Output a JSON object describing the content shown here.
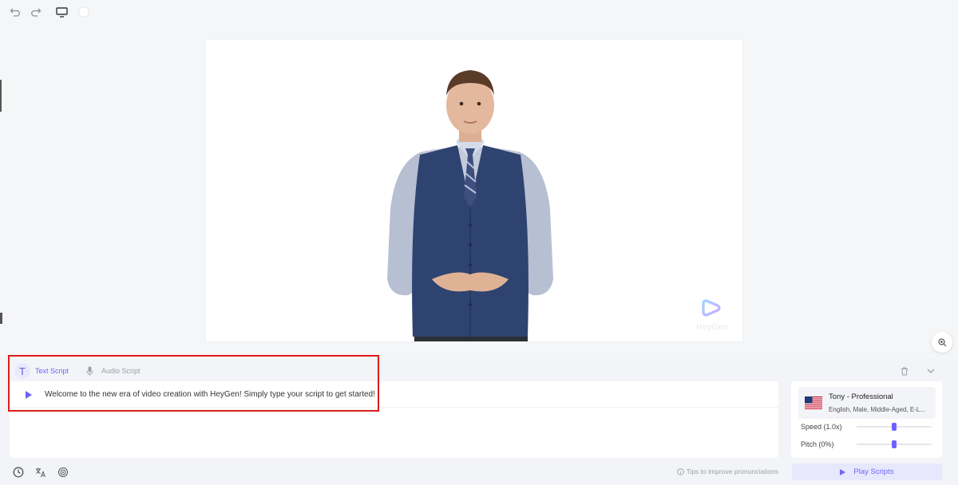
{
  "toolbar": {
    "undo_icon": "undo-icon",
    "redo_icon": "redo-icon",
    "monitor_icon": "monitor-icon"
  },
  "canvas": {
    "brand_text": "HeyGen"
  },
  "editor": {
    "tabs": [
      {
        "label": "Text Script",
        "icon": "text-icon",
        "active": true
      },
      {
        "label": "Audio Script",
        "icon": "microphone-icon",
        "active": false
      }
    ],
    "script_text": "Welcome to the new era of video creation with HeyGen! Simply type your script to get started!",
    "tips_label": "Tips to improve pronunciations"
  },
  "voice": {
    "name": "Tony - Professional",
    "description": "English, Male, Middle-Aged, E-L...",
    "speed_label": "Speed (1.0x)",
    "speed_level": 0.5,
    "pitch_label": "Pitch (0%)",
    "pitch_level": 0.5,
    "play_button_label": "Play Scripts"
  },
  "colors": {
    "accent": "#6c63ff",
    "highlight": "#e01b1b"
  }
}
